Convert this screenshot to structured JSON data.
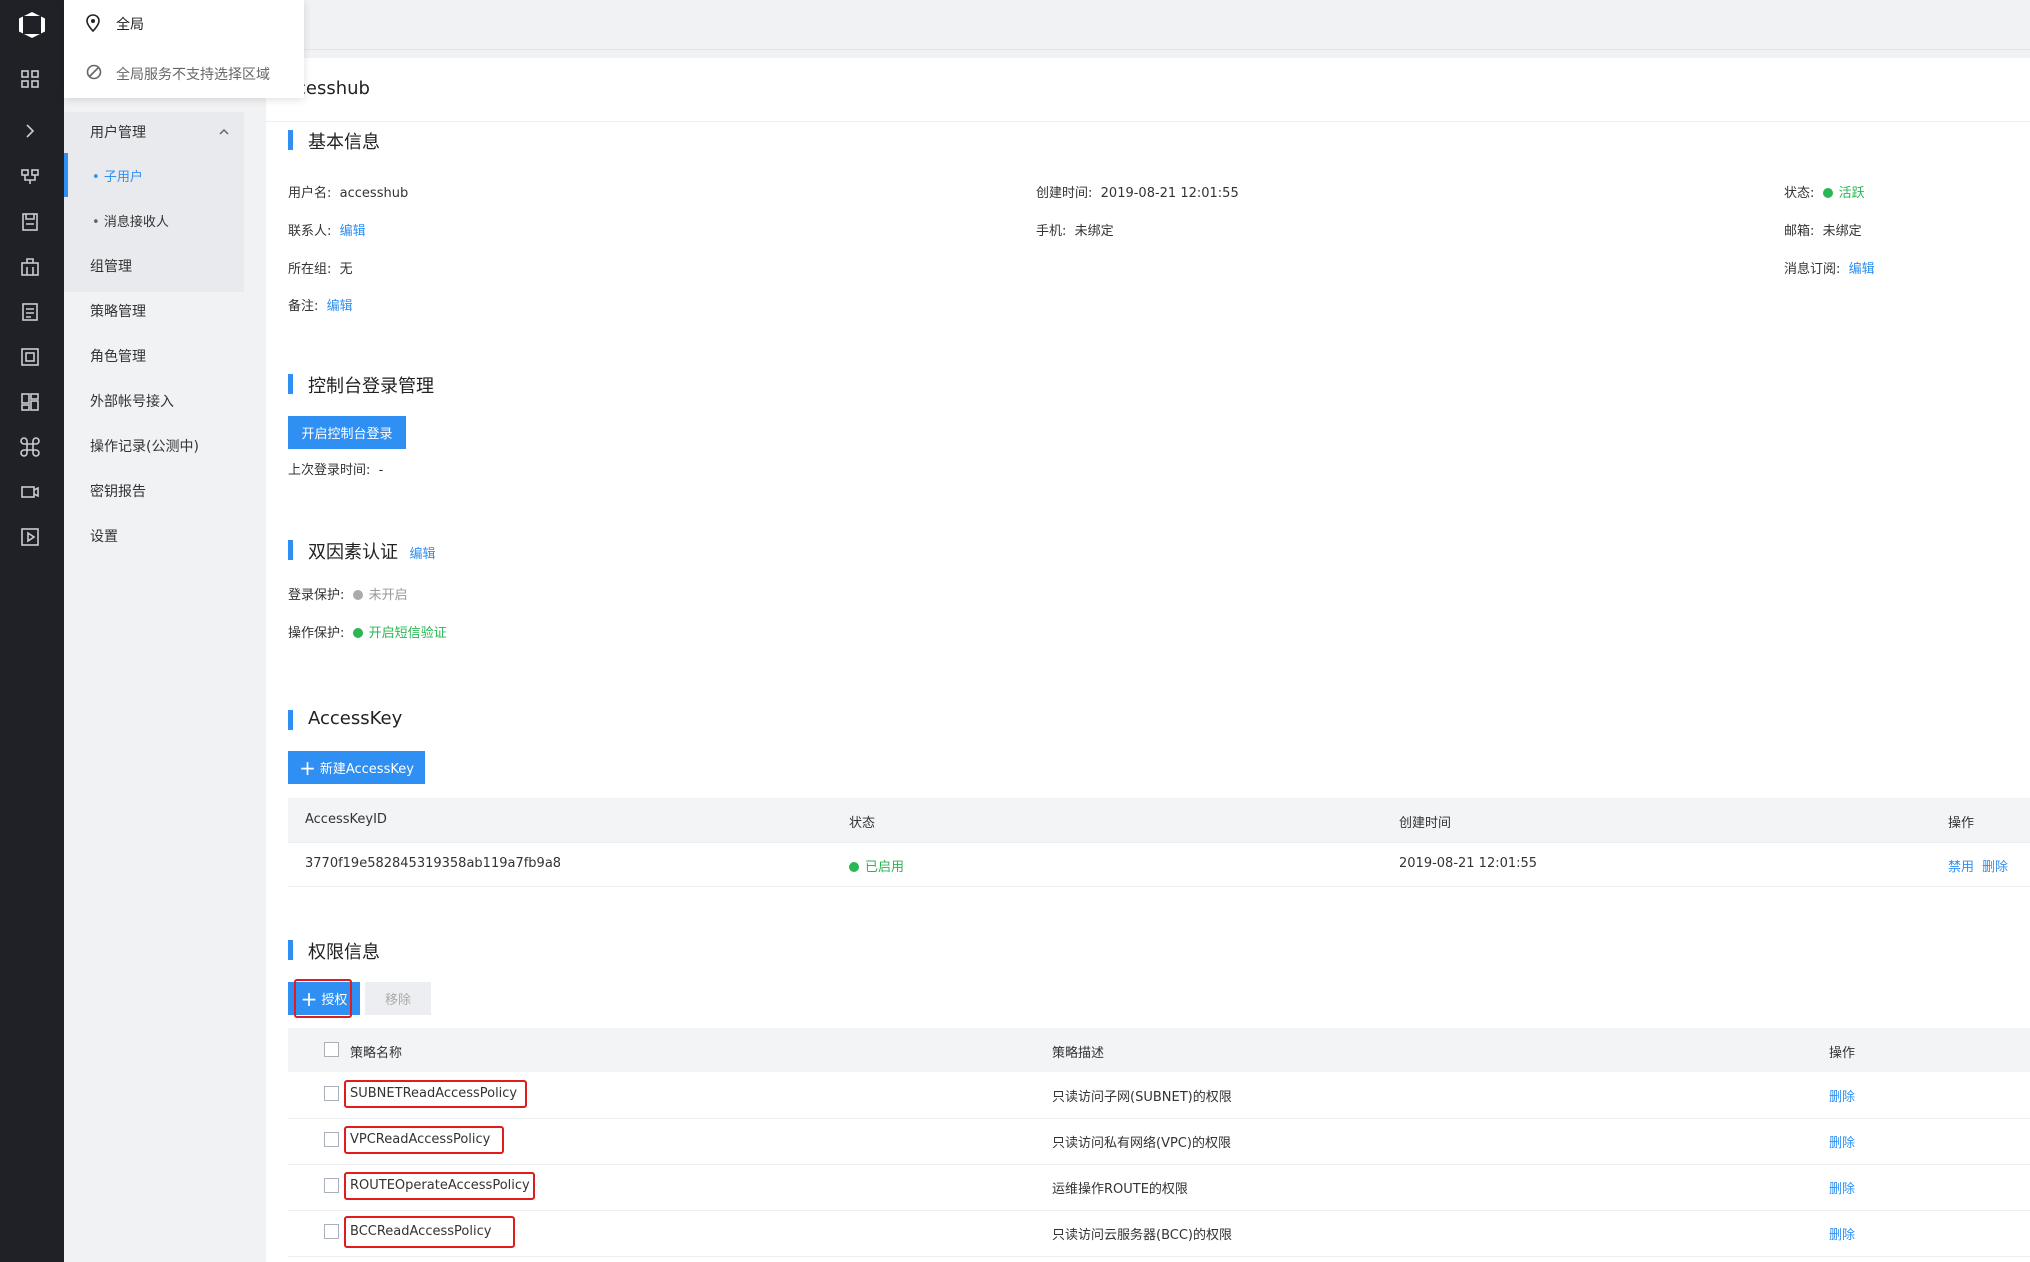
{
  "region": {
    "current": "全局",
    "notice": "全局服务不支持选择区域"
  },
  "page_title_partial": "cesshub",
  "sidebar": {
    "group_label": "用户管理",
    "items": [
      {
        "label": "子用户"
      },
      {
        "label": "消息接收人"
      },
      {
        "label": "组管理"
      },
      {
        "label": "策略管理"
      },
      {
        "label": "角色管理"
      },
      {
        "label": "外部帐号接入"
      },
      {
        "label": "操作记录(公测中)"
      },
      {
        "label": "密钥报告"
      },
      {
        "label": "设置"
      }
    ]
  },
  "basic": {
    "title": "基本信息",
    "username_label": "用户名:",
    "username": "accesshub",
    "created_label": "创建时间:",
    "created": "2019-08-21 12:01:55",
    "status_label": "状态:",
    "status": "活跃",
    "contact_label": "联系人:",
    "contact_edit": "编辑",
    "phone_label": "手机:",
    "phone": "未绑定",
    "email_label": "邮箱:",
    "email": "未绑定",
    "group_label": "所在组:",
    "group": "无",
    "subscribe_label": "消息订阅:",
    "subscribe_edit": "编辑",
    "remark_label": "备注:",
    "remark_edit": "编辑"
  },
  "console": {
    "title": "控制台登录管理",
    "enable_button": "开启控制台登录",
    "last_login_label": "上次登录时间:",
    "last_login": "-"
  },
  "twofa": {
    "title": "双因素认证",
    "edit": "编辑",
    "login_label": "登录保护:",
    "login_status": "未开启",
    "op_label": "操作保护:",
    "op_status": "开启短信验证"
  },
  "accesskey": {
    "title": "AccessKey",
    "new_button": "新建AccessKey",
    "columns": [
      "AccessKeyID",
      "状态",
      "创建时间",
      "操作"
    ],
    "rows": [
      {
        "id": "3770f19e582845319358ab119a7fb9a8",
        "status": "已启用",
        "created": "2019-08-21 12:01:55",
        "disable": "禁用",
        "delete": "删除"
      }
    ]
  },
  "permissions": {
    "title": "权限信息",
    "grant_button": "授权",
    "remove_button": "移除",
    "columns": [
      "策略名称",
      "策略描述",
      "操作"
    ],
    "rows": [
      {
        "name": "SUBNETReadAccessPolicy",
        "desc": "只读访问子网(SUBNET)的权限",
        "action": "删除"
      },
      {
        "name": "VPCReadAccessPolicy",
        "desc": "只读访问私有网络(VPC)的权限",
        "action": "删除"
      },
      {
        "name": "ROUTEOperateAccessPolicy",
        "desc": "运维操作ROUTE的权限",
        "action": "删除"
      },
      {
        "name": "BCCReadAccessPolicy",
        "desc": "只读访问云服务器(BCC)的权限",
        "action": "删除"
      }
    ]
  },
  "colors": {
    "accent": "#2f8ff2",
    "success": "#2ab653",
    "rail": "#1f2126",
    "highlight": "#e01c1c"
  }
}
